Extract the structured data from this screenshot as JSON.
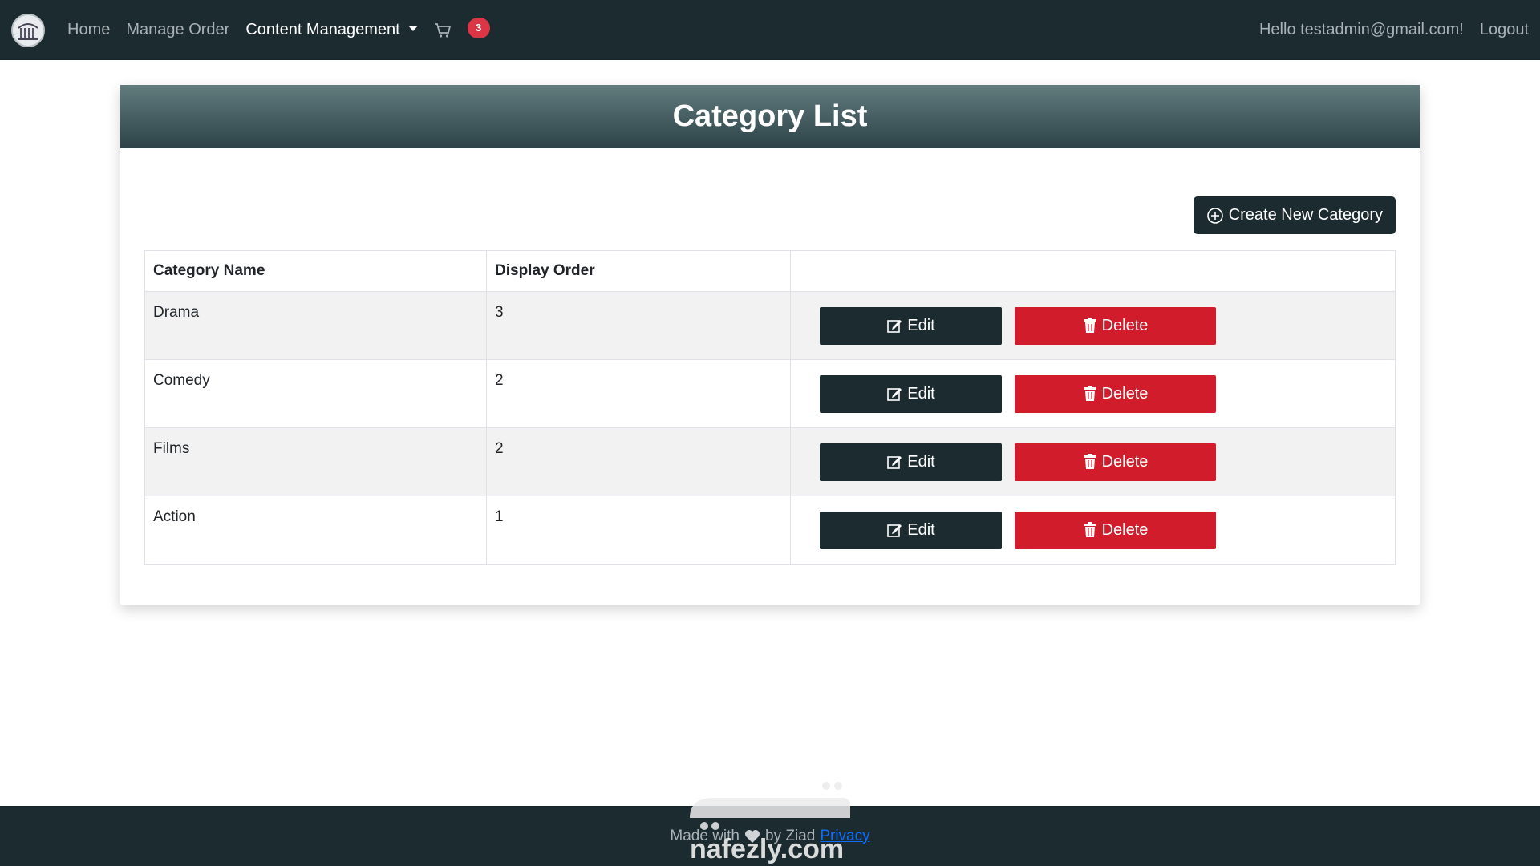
{
  "navbar": {
    "links": {
      "home": "Home",
      "manage_order": "Manage Order",
      "content_management": "Content Management"
    },
    "cart_count": "3",
    "greeting": "Hello testadmin@gmail.com!",
    "logout": "Logout",
    "icons": {
      "brand": "library-logo-icon",
      "cart": "cart-icon",
      "dropdown": "chevron-down-icon"
    }
  },
  "card": {
    "title": "Category List",
    "create_button": "Create New Category"
  },
  "table": {
    "headers": [
      "Category Name",
      "Display Order",
      ""
    ],
    "rows": [
      {
        "name": "Drama",
        "order": "3"
      },
      {
        "name": "Comedy",
        "order": "2"
      },
      {
        "name": "Films",
        "order": "2"
      },
      {
        "name": "Action",
        "order": "1"
      }
    ],
    "edit_label": "Edit",
    "delete_label": "Delete"
  },
  "footer": {
    "text": "Made with",
    "by": "by Ziad",
    "privacy": "Privacy"
  },
  "watermark": {
    "en": "nafezly.com"
  },
  "colors": {
    "navbar": "#1c2b30",
    "danger": "#d01c2b",
    "badge": "#dc3545",
    "link": "#0d6efd"
  }
}
